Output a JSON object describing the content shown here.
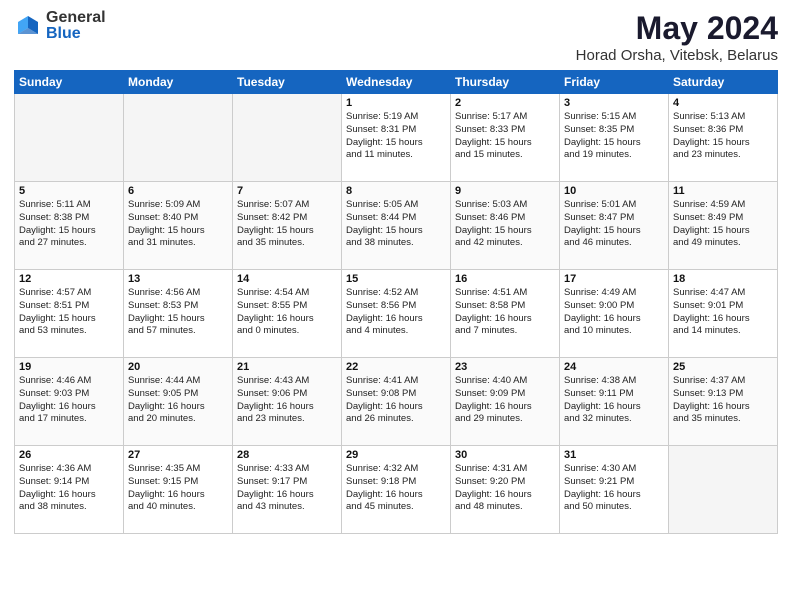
{
  "header": {
    "logo_general": "General",
    "logo_blue": "Blue",
    "title": "May 2024",
    "subtitle": "Horad Orsha, Vitebsk, Belarus"
  },
  "weekdays": [
    "Sunday",
    "Monday",
    "Tuesday",
    "Wednesday",
    "Thursday",
    "Friday",
    "Saturday"
  ],
  "weeks": [
    [
      {
        "num": "",
        "detail": ""
      },
      {
        "num": "",
        "detail": ""
      },
      {
        "num": "",
        "detail": ""
      },
      {
        "num": "1",
        "detail": "Sunrise: 5:19 AM\nSunset: 8:31 PM\nDaylight: 15 hours\nand 11 minutes."
      },
      {
        "num": "2",
        "detail": "Sunrise: 5:17 AM\nSunset: 8:33 PM\nDaylight: 15 hours\nand 15 minutes."
      },
      {
        "num": "3",
        "detail": "Sunrise: 5:15 AM\nSunset: 8:35 PM\nDaylight: 15 hours\nand 19 minutes."
      },
      {
        "num": "4",
        "detail": "Sunrise: 5:13 AM\nSunset: 8:36 PM\nDaylight: 15 hours\nand 23 minutes."
      }
    ],
    [
      {
        "num": "5",
        "detail": "Sunrise: 5:11 AM\nSunset: 8:38 PM\nDaylight: 15 hours\nand 27 minutes."
      },
      {
        "num": "6",
        "detail": "Sunrise: 5:09 AM\nSunset: 8:40 PM\nDaylight: 15 hours\nand 31 minutes."
      },
      {
        "num": "7",
        "detail": "Sunrise: 5:07 AM\nSunset: 8:42 PM\nDaylight: 15 hours\nand 35 minutes."
      },
      {
        "num": "8",
        "detail": "Sunrise: 5:05 AM\nSunset: 8:44 PM\nDaylight: 15 hours\nand 38 minutes."
      },
      {
        "num": "9",
        "detail": "Sunrise: 5:03 AM\nSunset: 8:46 PM\nDaylight: 15 hours\nand 42 minutes."
      },
      {
        "num": "10",
        "detail": "Sunrise: 5:01 AM\nSunset: 8:47 PM\nDaylight: 15 hours\nand 46 minutes."
      },
      {
        "num": "11",
        "detail": "Sunrise: 4:59 AM\nSunset: 8:49 PM\nDaylight: 15 hours\nand 49 minutes."
      }
    ],
    [
      {
        "num": "12",
        "detail": "Sunrise: 4:57 AM\nSunset: 8:51 PM\nDaylight: 15 hours\nand 53 minutes."
      },
      {
        "num": "13",
        "detail": "Sunrise: 4:56 AM\nSunset: 8:53 PM\nDaylight: 15 hours\nand 57 minutes."
      },
      {
        "num": "14",
        "detail": "Sunrise: 4:54 AM\nSunset: 8:55 PM\nDaylight: 16 hours\nand 0 minutes."
      },
      {
        "num": "15",
        "detail": "Sunrise: 4:52 AM\nSunset: 8:56 PM\nDaylight: 16 hours\nand 4 minutes."
      },
      {
        "num": "16",
        "detail": "Sunrise: 4:51 AM\nSunset: 8:58 PM\nDaylight: 16 hours\nand 7 minutes."
      },
      {
        "num": "17",
        "detail": "Sunrise: 4:49 AM\nSunset: 9:00 PM\nDaylight: 16 hours\nand 10 minutes."
      },
      {
        "num": "18",
        "detail": "Sunrise: 4:47 AM\nSunset: 9:01 PM\nDaylight: 16 hours\nand 14 minutes."
      }
    ],
    [
      {
        "num": "19",
        "detail": "Sunrise: 4:46 AM\nSunset: 9:03 PM\nDaylight: 16 hours\nand 17 minutes."
      },
      {
        "num": "20",
        "detail": "Sunrise: 4:44 AM\nSunset: 9:05 PM\nDaylight: 16 hours\nand 20 minutes."
      },
      {
        "num": "21",
        "detail": "Sunrise: 4:43 AM\nSunset: 9:06 PM\nDaylight: 16 hours\nand 23 minutes."
      },
      {
        "num": "22",
        "detail": "Sunrise: 4:41 AM\nSunset: 9:08 PM\nDaylight: 16 hours\nand 26 minutes."
      },
      {
        "num": "23",
        "detail": "Sunrise: 4:40 AM\nSunset: 9:09 PM\nDaylight: 16 hours\nand 29 minutes."
      },
      {
        "num": "24",
        "detail": "Sunrise: 4:38 AM\nSunset: 9:11 PM\nDaylight: 16 hours\nand 32 minutes."
      },
      {
        "num": "25",
        "detail": "Sunrise: 4:37 AM\nSunset: 9:13 PM\nDaylight: 16 hours\nand 35 minutes."
      }
    ],
    [
      {
        "num": "26",
        "detail": "Sunrise: 4:36 AM\nSunset: 9:14 PM\nDaylight: 16 hours\nand 38 minutes."
      },
      {
        "num": "27",
        "detail": "Sunrise: 4:35 AM\nSunset: 9:15 PM\nDaylight: 16 hours\nand 40 minutes."
      },
      {
        "num": "28",
        "detail": "Sunrise: 4:33 AM\nSunset: 9:17 PM\nDaylight: 16 hours\nand 43 minutes."
      },
      {
        "num": "29",
        "detail": "Sunrise: 4:32 AM\nSunset: 9:18 PM\nDaylight: 16 hours\nand 45 minutes."
      },
      {
        "num": "30",
        "detail": "Sunrise: 4:31 AM\nSunset: 9:20 PM\nDaylight: 16 hours\nand 48 minutes."
      },
      {
        "num": "31",
        "detail": "Sunrise: 4:30 AM\nSunset: 9:21 PM\nDaylight: 16 hours\nand 50 minutes."
      },
      {
        "num": "",
        "detail": ""
      }
    ]
  ]
}
